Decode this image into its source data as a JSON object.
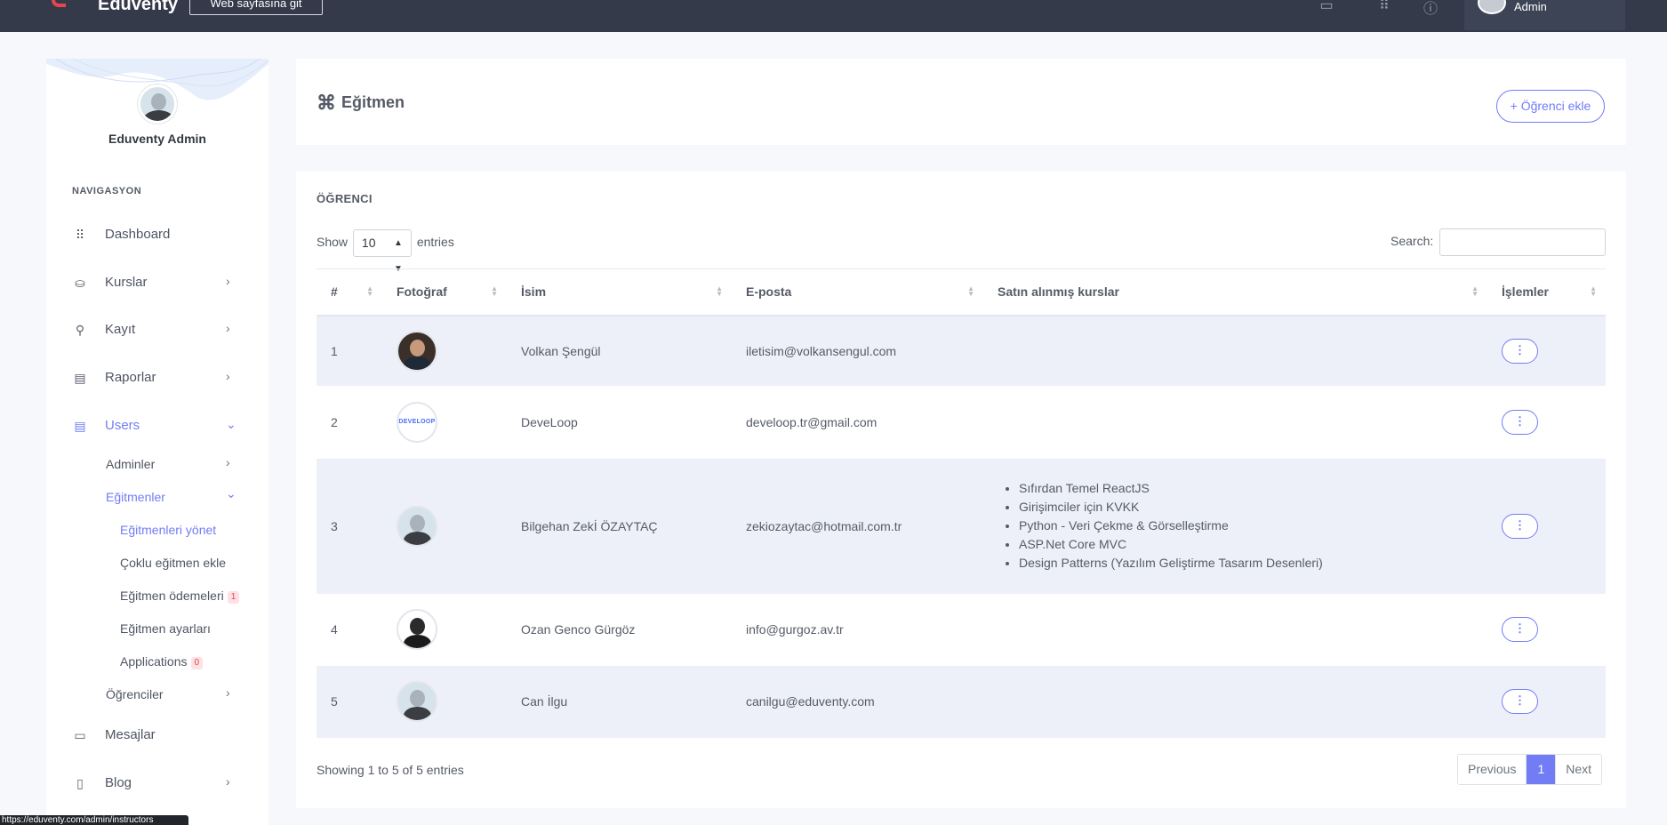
{
  "topbar": {
    "brand": "Eduventy",
    "site_button": "Web sayfasına git",
    "user_name": "Admin"
  },
  "sidebar": {
    "profile_name": "Eduventy Admin",
    "nav_title": "NAVIGASYON",
    "items": [
      {
        "label": "Dashboard",
        "icon": "grid-icon"
      },
      {
        "label": "Kurslar",
        "icon": "basket-icon"
      },
      {
        "label": "Kayıt",
        "icon": "hierarchy-icon"
      },
      {
        "label": "Raporlar",
        "icon": "archive-icon"
      },
      {
        "label": "Users",
        "icon": "archive-icon"
      },
      {
        "label": "Mesajlar",
        "icon": "message-icon"
      },
      {
        "label": "Blog",
        "icon": "document-icon"
      }
    ],
    "users_sub": {
      "adminler": "Adminler",
      "egitmenler": "Eğitmenler",
      "egitmenleri_yonet": "Eğitmenleri yönet",
      "coklu_egitmen_ekle": "Çoklu eğitmen ekle",
      "egitmen_odemeleri": "Eğitmen ödemeleri",
      "egitmen_odemeleri_badge": "1",
      "egitmen_ayarlari": "Eğitmen ayarları",
      "applications": "Applications",
      "applications_badge": "0",
      "ogrenciler": "Öğrenciler"
    }
  },
  "header": {
    "title": "Eğitmen",
    "add_button": "+ Öğrenci ekle"
  },
  "table_card": {
    "title": "ÖĞRENCI",
    "show_label": "Show",
    "show_value": "10",
    "entries_label": "entries",
    "search_label": "Search:",
    "columns": [
      "#",
      "Fotoğraf",
      "İsim",
      "E-posta",
      "Satın alınmış kurslar",
      "İşlemler"
    ],
    "rows": [
      {
        "num": "1",
        "name": "Volkan Şengül",
        "email": "iletisim@volkansengul.com",
        "courses": []
      },
      {
        "num": "2",
        "name": "DeveLoop",
        "email": "develoop.tr@gmail.com",
        "photo_text": "DEVELOOP",
        "courses": []
      },
      {
        "num": "3",
        "name": "Bilgehan Zekİ ÖZAYTAÇ",
        "email": "zekiozaytac@hotmail.com.tr",
        "courses": [
          "Sıfırdan Temel ReactJS",
          "Girişimciler için KVKK",
          "Python - Veri Çekme & Görselleştirme",
          "ASP.Net Core MVC",
          "Design Patterns (Yazılım Geliştirme Tasarım Desenleri)"
        ]
      },
      {
        "num": "4",
        "name": "Ozan Genco Gürgöz",
        "email": "info@gurgoz.av.tr",
        "courses": []
      },
      {
        "num": "5",
        "name": "Can İlgu",
        "email": "canilgu@eduventy.com",
        "courses": []
      }
    ],
    "info": "Showing 1 to 5 of 5 entries",
    "pager": {
      "prev": "Previous",
      "current": "1",
      "next": "Next"
    }
  },
  "statusbar": "https://eduventy.com/admin/instructors",
  "colors": {
    "accent": "#727cf5",
    "topbar": "#343a4a",
    "row_stripe": "#eef0f9",
    "badge": "#e8464f"
  }
}
